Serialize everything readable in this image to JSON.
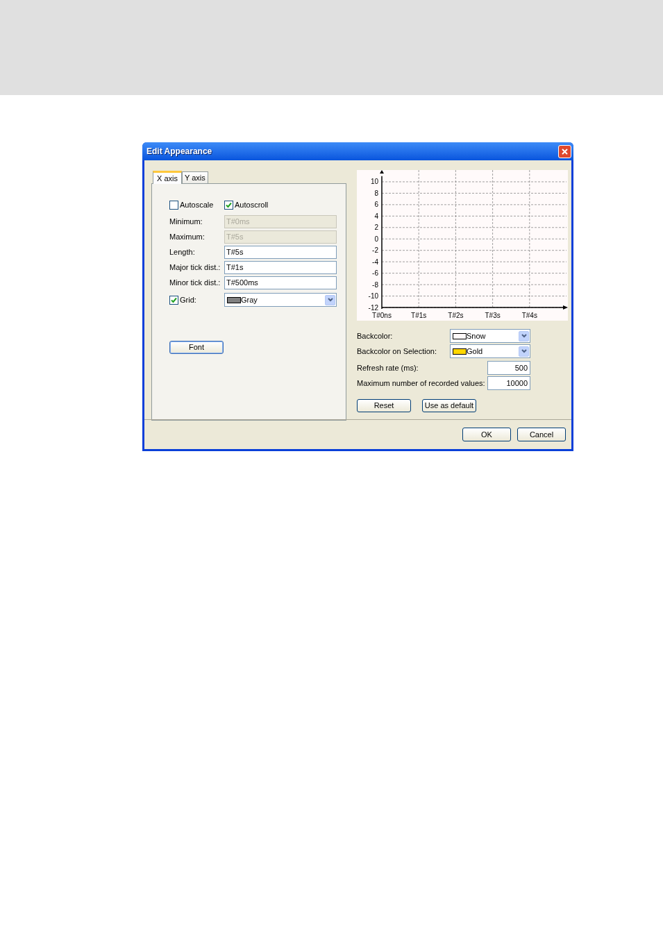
{
  "window": {
    "title": "Edit Appearance"
  },
  "tabs": [
    {
      "label": "X axis",
      "selected": true
    },
    {
      "label": "Y axis",
      "selected": false
    }
  ],
  "checkboxes": [
    {
      "label": "Autoscale",
      "checked": false
    },
    {
      "label": "Autoscroll",
      "checked": true
    }
  ],
  "fields": [
    {
      "label": "Minimum:",
      "value": "T#0ms",
      "disabled": true
    },
    {
      "label": "Maximum:",
      "value": "T#5s",
      "disabled": true
    },
    {
      "label": "Length:",
      "value": "T#5s",
      "disabled": false
    },
    {
      "label": "Major tick dist.:",
      "value": "T#1s",
      "disabled": false
    },
    {
      "label": "Minor tick dist.:",
      "value": "T#500ms",
      "disabled": false
    }
  ],
  "grid": {
    "label": "Grid:",
    "checked": true,
    "value": "Gray",
    "color": "#808080"
  },
  "font_button": "Font",
  "preview": {
    "chart_data": {
      "type": "line",
      "grid": true,
      "xlim": [
        0,
        5
      ],
      "ylim": [
        -12,
        11
      ],
      "xticks": [
        {
          "value": 0,
          "label": "T#0ns"
        },
        {
          "value": 1,
          "label": "T#1s"
        },
        {
          "value": 2,
          "label": "T#2s"
        },
        {
          "value": 3,
          "label": "T#3s"
        },
        {
          "value": 4,
          "label": "T#4s"
        }
      ],
      "yticks": [
        10,
        8,
        6,
        4,
        2,
        0,
        -2,
        -4,
        -6,
        -8,
        -10,
        -12
      ]
    }
  },
  "color_fields": [
    {
      "label": "Backcolor:",
      "value": "Snow",
      "color": "#fffafa"
    },
    {
      "label": "Backcolor on Selection:",
      "value": "Gold",
      "color": "#ffd700"
    }
  ],
  "number_fields": [
    {
      "label": "Refresh rate (ms):",
      "value": "500"
    },
    {
      "label": "Maximum number of recorded values:",
      "value": "10000"
    }
  ],
  "action_buttons": [
    "Reset",
    "Use as default"
  ],
  "dialog_buttons": [
    "OK",
    "Cancel"
  ]
}
